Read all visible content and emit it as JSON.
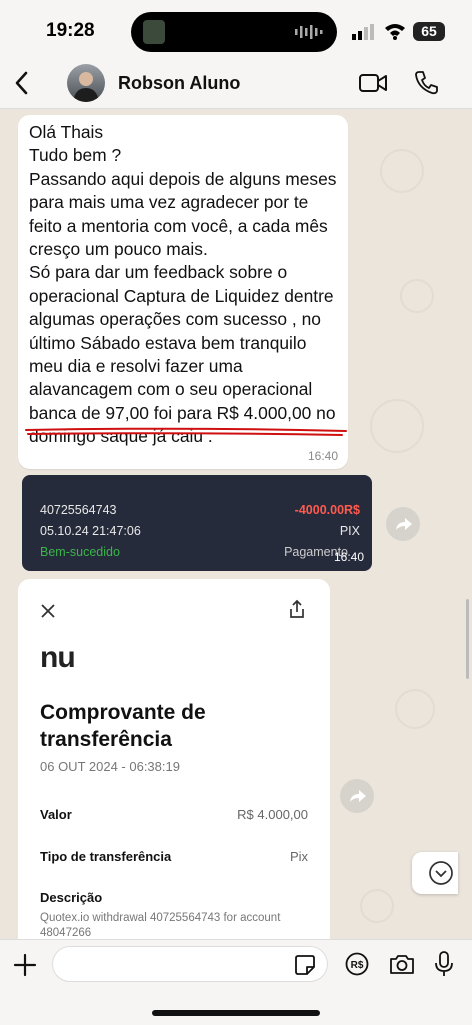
{
  "status": {
    "time": "19:28",
    "battery": "65"
  },
  "header": {
    "contact_name": "Robson Aluno"
  },
  "messages": {
    "m1": {
      "text": "Olá Thais\nTudo bem ?\nPassando aqui depois de alguns meses\npara mais uma vez agradecer por te\nfeito a mentoria com você, a cada mês\ncresço um pouco mais.\nSó para dar um feedback sobre o\noperacional Captura de Liquidez  dentre\nalgumas operações com sucesso  , no\núltimo Sábado estava bem tranquilo\nmeu dia e resolvi fazer uma\nalavancagem com o seu operacional\nbanca de 97,00 foi para R$ 4.000,00 no\ndomingo saque já caiu .",
      "time": "16:40"
    },
    "m2": {
      "id": "40725564743",
      "amount": "-4000.00R$",
      "datetime": "05.10.24 21:47:06",
      "method": "PIX",
      "status": "Bem-sucedido",
      "label": "Pagamento",
      "time": "16:40"
    },
    "m3": {
      "logo": "nu",
      "title": "Comprovante de transferência",
      "date": "06 OUT 2024 - 06:38:19",
      "valor_label": "Valor",
      "valor": "R$ 4.000,00",
      "tipo_label": "Tipo de transferência",
      "tipo": "Pix",
      "descricao_label": "Descrição",
      "descricao": "Quotex.io withdrawal 40725564743 for account 48047266"
    }
  },
  "input": {
    "placeholder": ""
  },
  "colors": {
    "accent_green": "#3bb54a",
    "amount_red": "#ff5a4e",
    "underline_red": "#d01010",
    "nubank_purple": "#222"
  }
}
